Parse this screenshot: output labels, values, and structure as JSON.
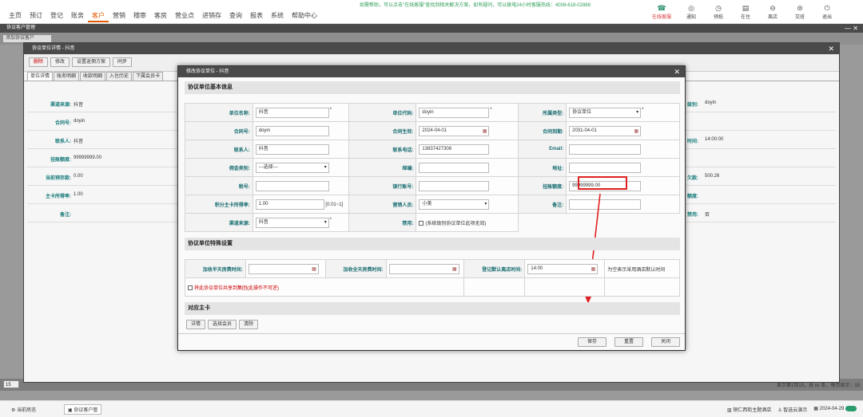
{
  "nav": {
    "items": [
      "主页",
      "预订",
      "登记",
      "账务",
      "客户",
      "营销",
      "稽审",
      "客房",
      "营业点",
      "进销存",
      "查询",
      "报表",
      "系统",
      "帮助中心"
    ],
    "active_index": 4,
    "help_text": "如需帮助，可以点击\"在线客服\"查找到相关解决方案，如有疑问，可以拨电24小时客服热线：4008-618-02888",
    "right_icons": [
      {
        "label": "在线客服",
        "icon": "headset-icon"
      },
      {
        "label": "通知",
        "icon": "bell-icon"
      },
      {
        "label": "预抵",
        "icon": "clock-icon"
      },
      {
        "label": "在住",
        "icon": "bed-icon"
      },
      {
        "label": "离店",
        "icon": "exit-icon"
      },
      {
        "label": "交班",
        "icon": "handover-icon"
      },
      {
        "label": "退出",
        "icon": "power-icon"
      }
    ]
  },
  "subheader": {
    "title": "协议客户管理",
    "min": "—",
    "close": "✕"
  },
  "filter": {
    "first": "添加协议客户"
  },
  "pager": {
    "size": "15",
    "info": "显示第1到15，总 xx 条，每页显示：15"
  },
  "dialog1": {
    "title": "协议单位详情 - 抖音",
    "close": "✕",
    "toolbar": [
      "删除",
      "修改",
      "设置返佣方案",
      "同步"
    ],
    "tabs": [
      "单位详情",
      "账务明细",
      "收款明细",
      "入住历史",
      "下属会员卡"
    ],
    "rows": [
      {
        "label": "渠道来源:",
        "value": "抖音",
        "rlabel": "级别:",
        "rvalue": "doyin"
      },
      {
        "label": "合同号:",
        "value": "doyin",
        "rlabel": "",
        "rvalue": ""
      },
      {
        "label": "联系人:",
        "value": "抖音",
        "rlabel": "时间:",
        "rvalue": "14:00:00"
      },
      {
        "label": "挂账额度:",
        "value": "99999999.00",
        "rlabel": "",
        "rvalue": ""
      },
      {
        "label": "当前预存款:",
        "value": "0.00",
        "rlabel": "欠款:",
        "rvalue": "500.26"
      },
      {
        "label": "主卡所得率:",
        "value": "1.00",
        "rlabel": "额度:",
        "rvalue": ""
      },
      {
        "label": "备注:",
        "value": "",
        "rlabel": "禁用:",
        "rvalue": "否"
      }
    ]
  },
  "dialog2": {
    "title": "修改协议单位 - 抖音",
    "close": "✕",
    "sections": {
      "basic": "协议单位基本信息",
      "special": "协议单位特殊设置",
      "card": "对应主卡"
    },
    "fields": {
      "unit_name": {
        "label": "单位名称:",
        "value": "抖音"
      },
      "unit_code": {
        "label": "单位代码:",
        "value": "doyin"
      },
      "type": {
        "label": "所属类型:",
        "value": "协议单位"
      },
      "contract_no": {
        "label": "合同号:",
        "value": "doyin"
      },
      "contract_start": {
        "label": "合同生效:",
        "value": "2024-04-01"
      },
      "contract_end": {
        "label": "合同到期:",
        "value": "2031-04-01"
      },
      "contact": {
        "label": "联系人:",
        "value": "抖音"
      },
      "phone": {
        "label": "联系电话:",
        "value": "13837427306"
      },
      "email": {
        "label": "Email:",
        "value": ""
      },
      "commission_type": {
        "label": "佣金类别:",
        "value": "---选择---"
      },
      "postcode": {
        "label": "邮编:",
        "value": ""
      },
      "address": {
        "label": "地址:",
        "value": ""
      },
      "tax_no": {
        "label": "税号:",
        "value": ""
      },
      "bank_account": {
        "label": "银行账号:",
        "value": ""
      },
      "credit_limit": {
        "label": "挂账额度:",
        "value": "99999999.00"
      },
      "points_rate": {
        "label": "积分主卡所得率:",
        "value": "1.00",
        "hint": "[0.01~1]"
      },
      "sales": {
        "label": "营销人员:",
        "value": "小美"
      },
      "remark": {
        "label": "备注:",
        "value": ""
      },
      "channel": {
        "label": "渠道来源:",
        "value": "抖音"
      },
      "disabled": {
        "label": "禁用:",
        "text": "(系统级别协议单位此项无效)"
      }
    },
    "special": {
      "half_day": {
        "label": "加收半天房费时间:",
        "value": ""
      },
      "full_day": {
        "label": "加收全天房费时间:",
        "value": ""
      },
      "checkout": {
        "label": "登记默认离店时间:",
        "value": "14:00"
      },
      "note": "为空表示采用酒店默认时间",
      "share": "将此协议单位共享到集团(此操作不可逆)"
    },
    "card_buttons": [
      "详情",
      "选择会员",
      "清除"
    ],
    "footer": [
      "保存",
      "重置",
      "关闭"
    ]
  },
  "bottombar": {
    "left": "当前房态",
    "tab": "协议客户管",
    "hotel": "铜仁西街主题酒店",
    "user": "智选云演示",
    "date": "2024-04-29"
  }
}
